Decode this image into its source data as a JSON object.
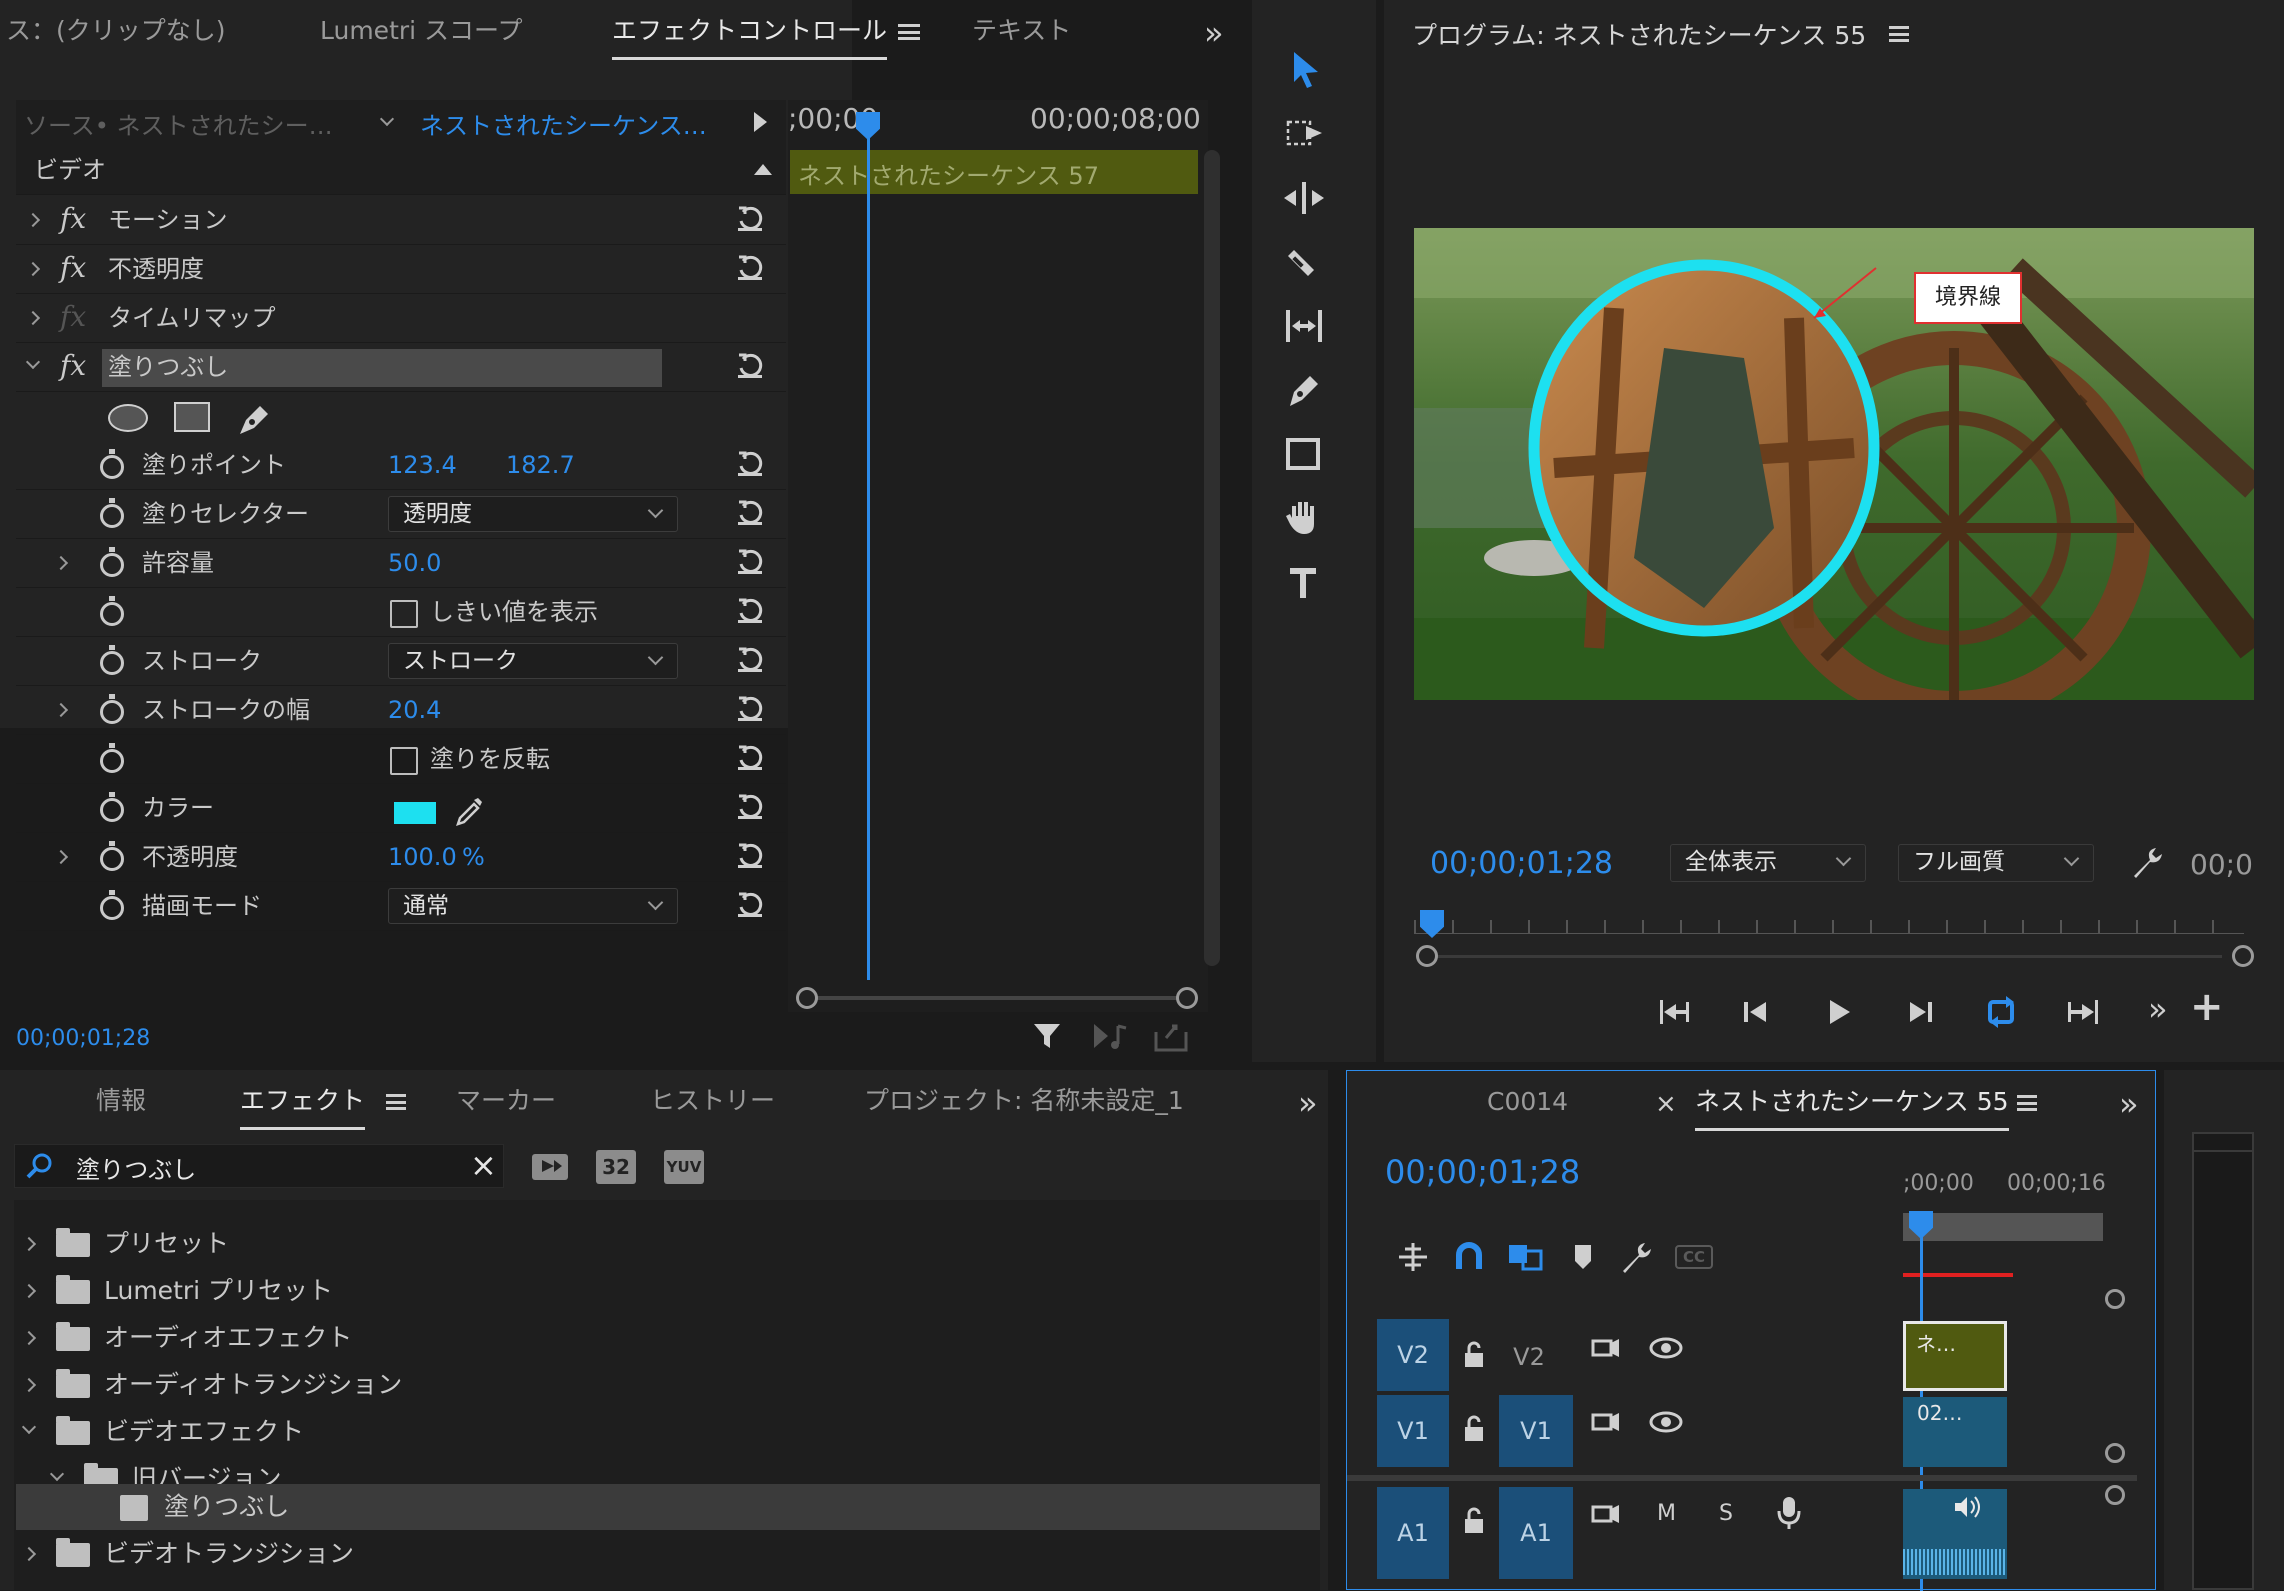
{
  "colors": {
    "accent": "#2d8ceb",
    "timecode": "#2d8ceb",
    "clip_green": "#505a10",
    "fill_color": "#1de0f0",
    "track_blue": "#1b4f79"
  },
  "effect_panel": {
    "tabs": [
      "ス：(クリップなし)",
      "Lumetri スコープ",
      "エフェクトコントロール",
      "テキスト"
    ],
    "source_label": "ソース• ネストされたシー…",
    "target_label": "ネストされたシーケンス…",
    "ruler_start": ";00;00",
    "ruler_end": "00;00;08;00",
    "clip_label": "ネストされたシーケンス 57",
    "video_header": "ビデオ",
    "effects": [
      {
        "name": "モーション"
      },
      {
        "name": "不透明度"
      },
      {
        "name": "タイムリマップ"
      },
      {
        "name": "塗りつぶし"
      }
    ],
    "params": {
      "fill_point_label": "塗りポイント",
      "fill_point_x": "123.4",
      "fill_point_y": "182.7",
      "selector_label": "塗りセレクター",
      "selector_value": "透明度",
      "tolerance_label": "許容量",
      "tolerance_value": "50.0",
      "threshold_label": "しきい値を表示",
      "stroke_label": "ストローク",
      "stroke_value": "ストローク",
      "stroke_width_label": "ストロークの幅",
      "stroke_width_value": "20.4",
      "invert_label": "塗りを反転",
      "color_label": "カラー",
      "opacity_label": "不透明度",
      "opacity_value": "100.0",
      "opacity_unit": "%",
      "blend_label": "描画モード",
      "blend_value": "通常"
    },
    "timecode": "00;00;01;28"
  },
  "program_monitor": {
    "title": "プログラム: ネストされたシーケンス 55",
    "timecode": "00;00;01;28",
    "fit_value": "全体表示",
    "quality_value": "フル画質",
    "end_timecode": "00;0",
    "callout": "境界線"
  },
  "effects_browser": {
    "tabs": [
      "情報",
      "エフェクト",
      "マーカー",
      "ヒストリー",
      "プロジェクト: 名称未設定_1"
    ],
    "search_value": "塗りつぶし",
    "icon_labels": [
      "32",
      "YUV"
    ],
    "items": [
      {
        "label": "プリセット"
      },
      {
        "label": "Lumetri プリセット"
      },
      {
        "label": "オーディオエフェクト"
      },
      {
        "label": "オーディオトランジション"
      },
      {
        "label": "ビデオエフェクト"
      },
      {
        "label": "旧バージョン"
      },
      {
        "label": "塗りつぶし"
      },
      {
        "label": "ビデオトランジション"
      }
    ]
  },
  "timeline": {
    "tabs": [
      "C0014",
      "ネストされたシーケンス 55"
    ],
    "timecode": "00;00;01;28",
    "ruler": [
      ";00;00",
      "00;00;16"
    ],
    "tracks": [
      {
        "id": "V2",
        "target": "V2",
        "clip": "ネ…"
      },
      {
        "id": "V1",
        "target": "V1",
        "clip": "02…"
      },
      {
        "id": "A1",
        "target": "A1",
        "m": "M",
        "s": "S"
      }
    ]
  }
}
